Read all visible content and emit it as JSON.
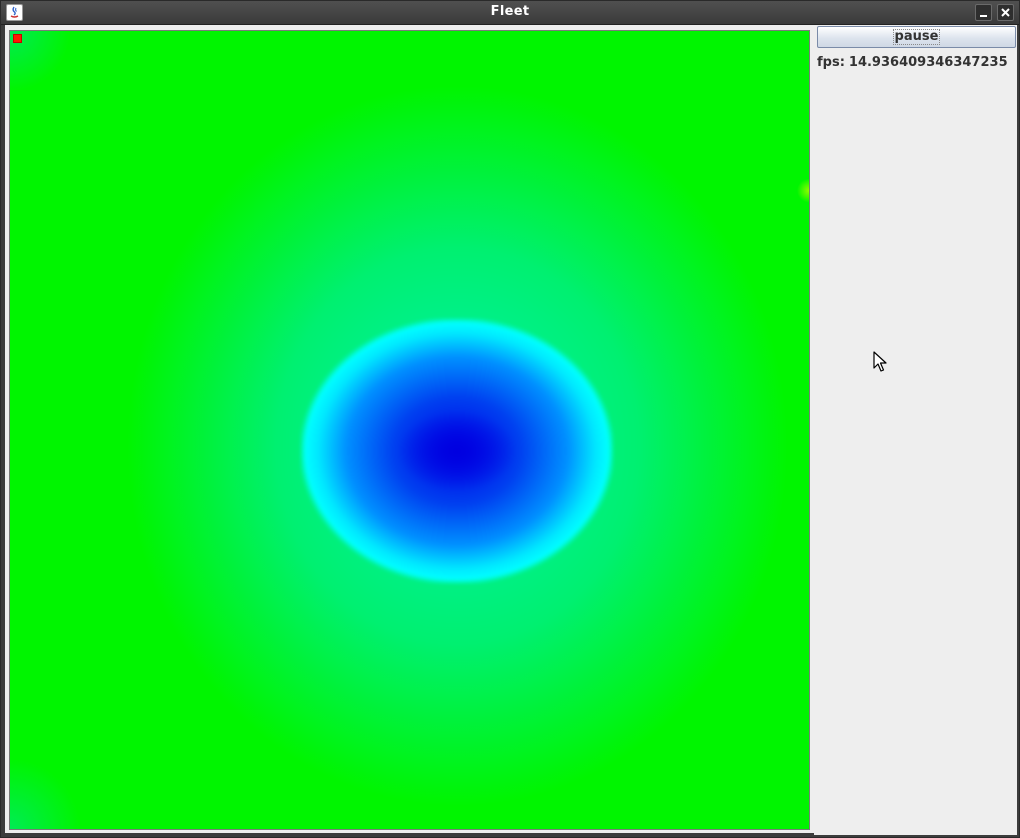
{
  "window": {
    "title": "Fleet"
  },
  "icons": {
    "app": "java-app-icon",
    "minimize": "minimize-icon",
    "close": "close-icon",
    "cursor": "mouse-pointer-icon"
  },
  "controls": {
    "pause_label": "pause"
  },
  "stats": {
    "fps_label": "fps:",
    "fps_value": "14.936409346347235"
  },
  "colors": {
    "field_green": "#00f500",
    "field_cyan": "#00ffff",
    "field_blue": "#0000e8",
    "agent_red": "#ff1a00",
    "panel_bg": "#eeeeee",
    "titlebar_bg": "#3c3c3c"
  }
}
